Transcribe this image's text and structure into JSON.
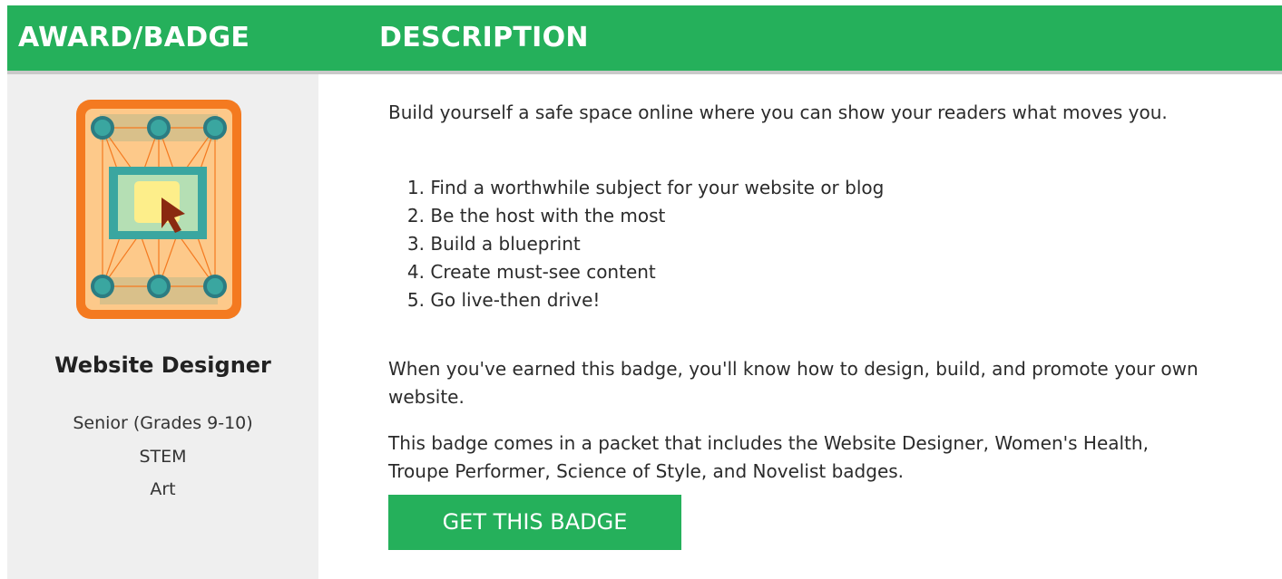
{
  "header": {
    "col_award": "AWARD/BADGE",
    "col_description": "DESCRIPTION"
  },
  "badge": {
    "name": "Website Designer",
    "meta": [
      "Senior (Grades 9-10)",
      "STEM",
      "Art"
    ],
    "icon": "website-designer-badge-icon",
    "colors": {
      "border": "#f47a20",
      "fill": "#fdc98a",
      "node": "#3aa6a0",
      "screen": "#b5dfb4",
      "cursor": "#8a2a10"
    }
  },
  "description": {
    "intro": "Build yourself a safe space online where you can show your readers what moves you.",
    "steps": [
      {
        "num": "1.",
        "text": "Find a worthwhile subject for your website or blog"
      },
      {
        "num": "2.",
        "text": "Be the host with the most"
      },
      {
        "num": "3.",
        "text": "Build a blueprint"
      },
      {
        "num": "4.",
        "text": "Create must-see content"
      },
      {
        "num": "5.",
        "text": "Go live-then drive!"
      }
    ],
    "earned": "When you've earned this badge, you'll know how to design, build, and promote your own website.",
    "packet": "This badge comes in a packet that includes the Website Designer, Women's Health, Troupe Performer, Science of Style, and Novelist badges.",
    "cta_label": "GET THIS BADGE"
  },
  "colors": {
    "accent": "#25b05b",
    "left_bg": "#efefef"
  }
}
